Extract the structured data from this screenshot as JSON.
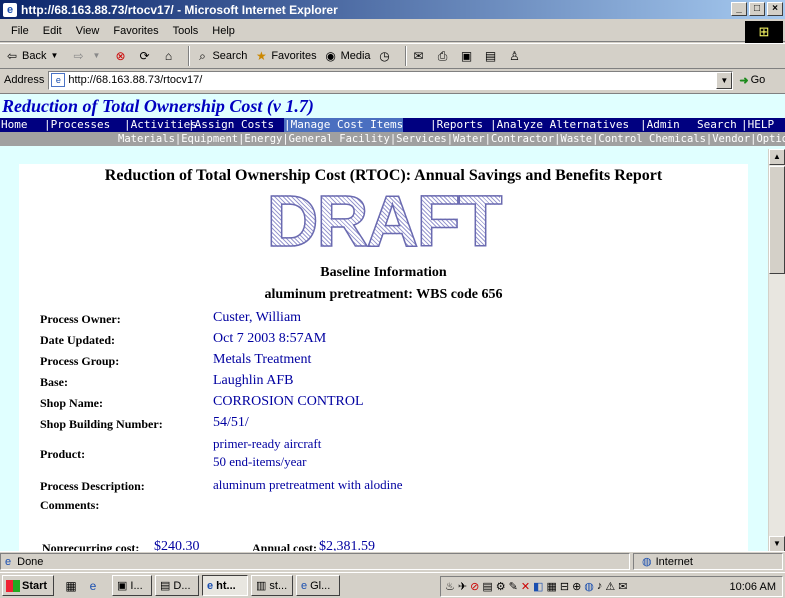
{
  "window": {
    "title": "http://68.163.88.73/rtocv17/ - Microsoft Internet Explorer",
    "buttons": {
      "minimize": "_",
      "maximize": "□",
      "close": "×"
    }
  },
  "menu": [
    "File",
    "Edit",
    "View",
    "Favorites",
    "Tools",
    "Help"
  ],
  "toolbar": {
    "back": "Back",
    "search": "Search",
    "favorites": "Favorites",
    "media": "Media"
  },
  "address": {
    "label": "Address",
    "url": "http://68.163.88.73/rtocv17/",
    "go": "Go"
  },
  "app": {
    "title": "Reduction of Total Ownership Cost (v 1.7)",
    "nav": [
      "Home",
      "|Processes",
      "|Activities",
      "|Assign Costs",
      "|Manage Cost Items",
      "|Reports",
      "|Analyze Alternatives",
      "|Admin",
      "Search",
      "|HELP"
    ],
    "subnav": "Materials|Equipment|Energy|General Facility|Services|Water|Contractor|Waste|Control Chemicals|Vendor|Optional Factors"
  },
  "report": {
    "title": "Reduction of Total Ownership Cost (RTOC): Annual Savings and Benefits Report",
    "watermark": "DRAFT",
    "section": "Baseline Information",
    "process_heading": "aluminum pretreatment: WBS code 656",
    "fields": [
      {
        "label": "Process Owner:",
        "value": "Custer, William"
      },
      {
        "label": "Date Updated:",
        "value": "Oct 7 2003 8:57AM"
      },
      {
        "label": "Process Group:",
        "value": "Metals Treatment"
      },
      {
        "label": "Base:",
        "value": "Laughlin AFB"
      },
      {
        "label": "Shop Name:",
        "value": "CORROSION CONTROL"
      },
      {
        "label": "Shop Building Number:",
        "value": "54/51/"
      },
      {
        "label": "Product:",
        "value": "primer-ready aircraft",
        "value2": "50 end-items/year"
      },
      {
        "label": "Process Description:",
        "value": "aluminum pretreatment with alodine"
      },
      {
        "label": "Comments:",
        "value": ""
      }
    ],
    "costs": {
      "nonrecurring_label": "Nonrecurring cost:",
      "nonrecurring_value": "$240.30",
      "annual_label": "Annual cost:",
      "annual_value": "$2,381.59"
    }
  },
  "status": {
    "text": "Done",
    "zone": "Internet"
  },
  "taskbar": {
    "start": "Start",
    "tasks": [
      "I...",
      "D...",
      "ht...",
      "st...",
      "Gl..."
    ],
    "clock": "10:06 AM"
  }
}
